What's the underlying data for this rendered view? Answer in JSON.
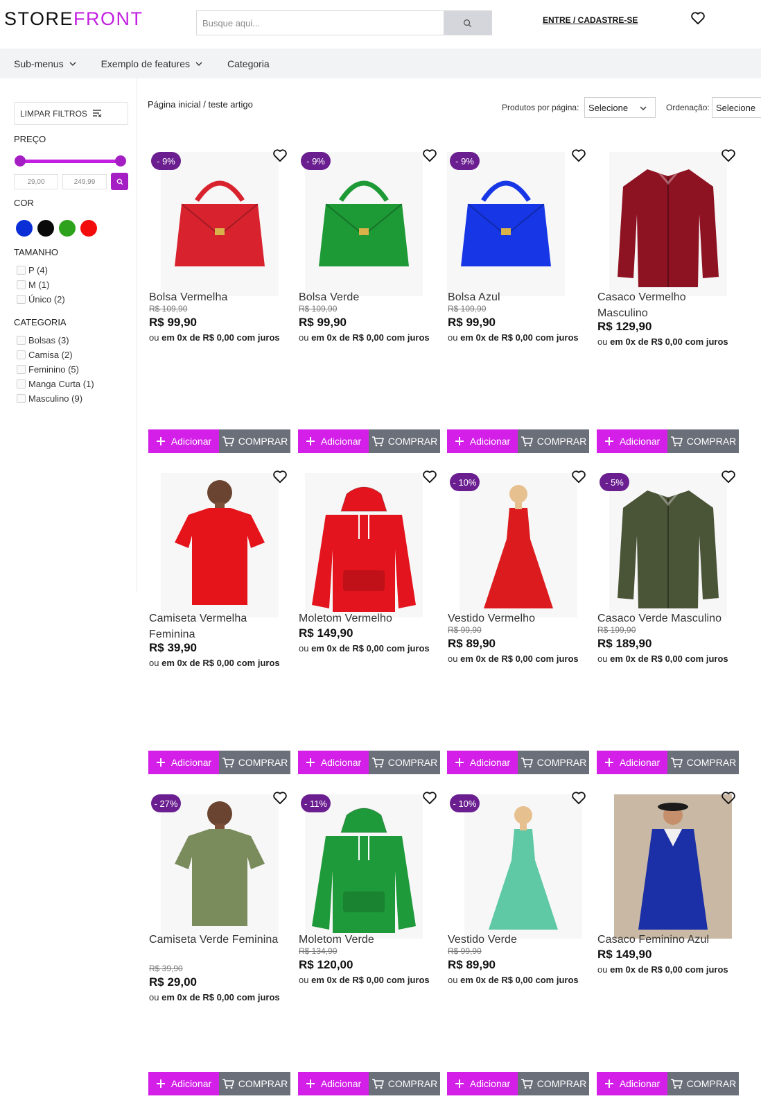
{
  "header": {
    "logo_part1": "STORE",
    "logo_part2": "FRONT",
    "search_placeholder": "Busque aqui...",
    "login_label": "ENTRE / CADASTRE-SE"
  },
  "nav": {
    "items": [
      {
        "label": "Sub-menus"
      },
      {
        "label": "Exemplo de features"
      },
      {
        "label": "Categoria"
      }
    ]
  },
  "sidebar": {
    "clear_label": "LIMPAR FILTROS",
    "price_title": "PREÇO",
    "price_min": "29,00",
    "price_max": "249,99",
    "color_title": "COR",
    "colors": [
      "#0a2fd6",
      "#0a0a0a",
      "#2ea21c",
      "#f20c0c"
    ],
    "size_title": "TAMANHO",
    "sizes": [
      {
        "label": "P (4)"
      },
      {
        "label": "M (1)"
      },
      {
        "label": "Único (2)"
      }
    ],
    "category_title": "CATEGORIA",
    "categories": [
      {
        "label": "Bolsas (3)"
      },
      {
        "label": "Camisa (2)"
      },
      {
        "label": "Feminino (5)"
      },
      {
        "label": "Manga Curta (1)"
      },
      {
        "label": "Masculino (9)"
      }
    ]
  },
  "toolbar": {
    "breadcrumb_home": "Página inicial",
    "breadcrumb_sep": "/",
    "breadcrumb_current": "teste artigo",
    "per_page_label": "Produtos por página:",
    "per_page_value": "Selecione",
    "order_label": "Ordenação:",
    "order_value": "Selecione"
  },
  "common": {
    "installment_prefix": "ou",
    "installment_text": "em 0x de R$ 0,00 com juros",
    "add_label": "Adicionar",
    "buy_label": "COMPRAR"
  },
  "products": [
    {
      "name": "Bolsa Vermelha",
      "old_price": "R$ 109,90",
      "price": "R$ 99,90",
      "badge": "- 9%",
      "image": "bag",
      "image_color": "#d8232f"
    },
    {
      "name": "Bolsa Verde",
      "old_price": "R$ 109,90",
      "price": "R$ 99,90",
      "badge": "- 9%",
      "image": "bag",
      "image_color": "#1d9a36"
    },
    {
      "name": "Bolsa Azul",
      "old_price": "R$ 109,90",
      "price": "R$ 99,90",
      "badge": "- 9%",
      "image": "bag",
      "image_color": "#1737e6"
    },
    {
      "name": "Casaco Vermelho Masculino",
      "old_price": "",
      "price": "R$ 129,90",
      "badge": "",
      "image": "jacket",
      "image_color": "#8e1322"
    },
    {
      "name": "Camiseta Vermelha Feminina",
      "old_price": "",
      "price": "R$ 39,90",
      "badge": "",
      "image": "tshirt",
      "image_color": "#e5141b"
    },
    {
      "name": "Moletom Vermelho",
      "old_price": "",
      "price": "R$ 149,90",
      "badge": "",
      "image": "hoodie",
      "image_color": "#e3141d"
    },
    {
      "name": "Vestido Vermelho",
      "old_price": "R$ 99,90",
      "price": "R$ 89,90",
      "badge": "- 10%",
      "image": "dress",
      "image_color": "#dc1b1f"
    },
    {
      "name": "Casaco Verde Masculino",
      "old_price": "R$ 199,90",
      "price": "R$ 189,90",
      "badge": "- 5%",
      "image": "jacket",
      "image_color": "#4a5436"
    },
    {
      "name": "Camiseta Verde Feminina",
      "old_price": "R$ 39,90",
      "price": "R$ 29,00",
      "badge": "- 27%",
      "image": "tshirt",
      "image_color": "#7a8c5c"
    },
    {
      "name": "Moletom Verde",
      "old_price": "R$ 134,90",
      "price": "R$ 120,00",
      "badge": "- 11%",
      "image": "hoodie",
      "image_color": "#1f9a3a"
    },
    {
      "name": "Vestido Verde",
      "old_price": "R$ 99,90",
      "price": "R$ 89,90",
      "badge": "- 10%",
      "image": "dress",
      "image_color": "#5ec9a4"
    },
    {
      "name": "Casaco Feminino Azul",
      "old_price": "",
      "price": "R$ 149,90",
      "badge": "",
      "image": "coat",
      "image_color": "#1b2fa6"
    }
  ]
}
